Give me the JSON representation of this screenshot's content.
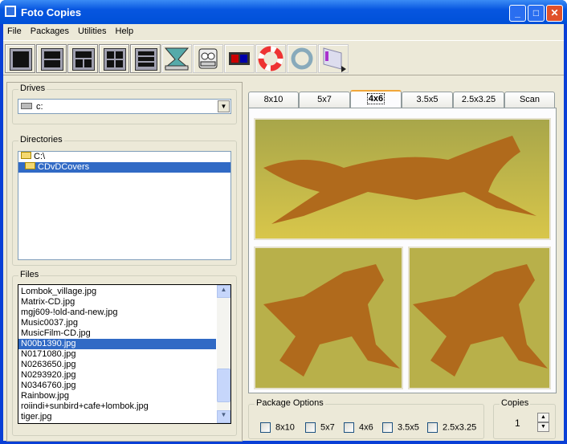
{
  "window": {
    "title": "Foto Copies",
    "controls": [
      "minimize",
      "maximize",
      "close"
    ]
  },
  "menu": [
    "File",
    "Packages",
    "Utilities",
    "Help"
  ],
  "toolbar": [
    {
      "icon": "layout-1-icon"
    },
    {
      "icon": "layout-2-icon"
    },
    {
      "icon": "layout-3-icon"
    },
    {
      "icon": "layout-4-icon"
    },
    {
      "icon": "layout-9-icon"
    },
    {
      "icon": "scanner-icon"
    },
    {
      "icon": "printer-face-icon"
    },
    {
      "icon": "film-icon"
    },
    {
      "icon": "lifebuoy-icon"
    },
    {
      "icon": "ring-icon"
    },
    {
      "icon": "fedex-icon"
    }
  ],
  "drives": {
    "label": "Drives",
    "value": "c:"
  },
  "directories": {
    "label": "Directories",
    "items": [
      "C:\\",
      "CDvDCovers"
    ],
    "selected": 1
  },
  "files": {
    "label": "Files",
    "items": [
      "Lombok_village.jpg",
      "Matrix-CD.jpg",
      "mgj609-!old-and-new.jpg",
      "Music0037.jpg",
      "MusicFilm-CD.jpg",
      "N00b1390.jpg",
      "N0171080.jpg",
      "N0263650.jpg",
      "N0293920.jpg",
      "N0346760.jpg",
      "Rainbow.jpg",
      "roiindi+sunbird+cafe+lombok.jpg",
      "tiger.jpg"
    ],
    "selected": 5
  },
  "tabs": [
    "8x10",
    "5x7",
    "4x6",
    "3.5x5",
    "2.5x3.25",
    "Scan"
  ],
  "active_tab": "4x6",
  "package_options": {
    "label": "Package Options",
    "options": [
      {
        "label": "8x10",
        "checked": false
      },
      {
        "label": "5x7",
        "checked": false
      },
      {
        "label": "4x6",
        "checked": false
      },
      {
        "label": "3.5x5",
        "checked": false
      },
      {
        "label": "2.5x3.25",
        "checked": false
      }
    ]
  },
  "copies": {
    "label": "Copies",
    "value": "1"
  }
}
